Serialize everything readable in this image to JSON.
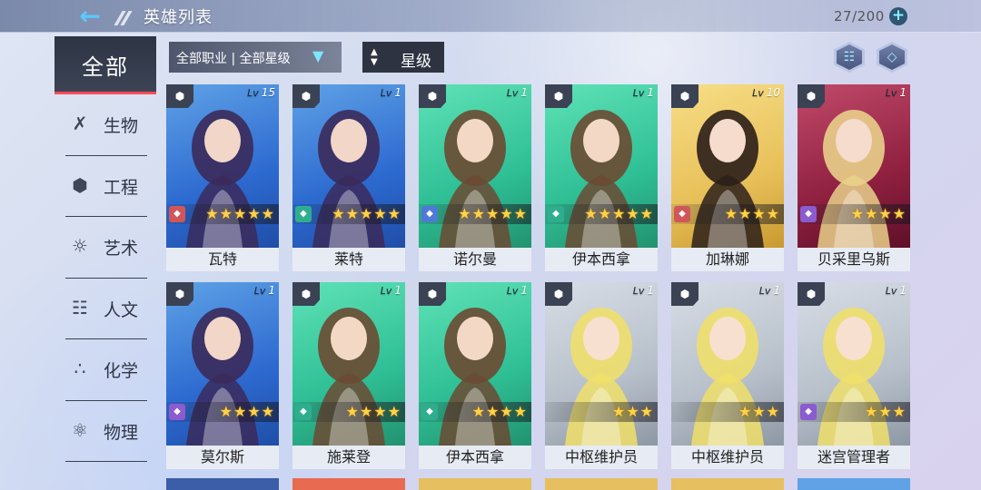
{
  "header": {
    "title": "英雄列表",
    "count": "27/200",
    "add_icon": "plus-icon",
    "back_icon": "back-arrow-icon"
  },
  "sidebar": {
    "all_label": "全部",
    "items": [
      {
        "label": "生物",
        "icon": "dna-icon"
      },
      {
        "label": "工程",
        "icon": "hexagon-cluster-icon"
      },
      {
        "label": "艺术",
        "icon": "palette-icon"
      },
      {
        "label": "人文",
        "icon": "book-icon"
      },
      {
        "label": "化学",
        "icon": "molecule-icon"
      },
      {
        "label": "物理",
        "icon": "atom-icon"
      }
    ]
  },
  "filters": {
    "class_rank": "全部职业 | 全部星级",
    "sort_label": "星级"
  },
  "toolbar": {
    "codex_icon": "book-icon",
    "settings_icon": "diamond-icon"
  },
  "heroes": [
    {
      "name": "瓦特",
      "level": "15",
      "stars": "★★★★★",
      "bg": "blue",
      "elem": "red"
    },
    {
      "name": "莱特",
      "level": "1",
      "stars": "★★★★★",
      "bg": "blue",
      "elem": "teal"
    },
    {
      "name": "诺尔曼",
      "level": "1",
      "stars": "★★★★★",
      "bg": "teal",
      "elem": "blue"
    },
    {
      "name": "伊本西拿",
      "level": "1",
      "stars": "★★★★★",
      "bg": "teal",
      "elem": "teal"
    },
    {
      "name": "加琳娜",
      "level": "10",
      "stars": "★★★★",
      "bg": "gold",
      "elem": "red"
    },
    {
      "name": "贝采里乌斯",
      "level": "1",
      "stars": "★★★★",
      "bg": "red",
      "elem": "purple"
    },
    {
      "name": "莫尔斯",
      "level": "1",
      "stars": "★★★★",
      "bg": "blue",
      "elem": "purple"
    },
    {
      "name": "施莱登",
      "level": "1",
      "stars": "★★★★",
      "bg": "teal",
      "elem": "teal"
    },
    {
      "name": "伊本西拿",
      "level": "1",
      "stars": "★★★★",
      "bg": "teal",
      "elem": "teal"
    },
    {
      "name": "中枢维护员",
      "level": "1",
      "stars": "★★★",
      "bg": "gray",
      "elem": "none"
    },
    {
      "name": "中枢维护员",
      "level": "1",
      "stars": "★★★",
      "bg": "gray",
      "elem": "none"
    },
    {
      "name": "迷宫管理者",
      "level": "1",
      "stars": "★★★",
      "bg": "gray",
      "elem": "purple"
    }
  ],
  "colors": {
    "accent": "#ff4a5a",
    "cyan": "#5cc8ff",
    "star": "#ffd24a"
  }
}
